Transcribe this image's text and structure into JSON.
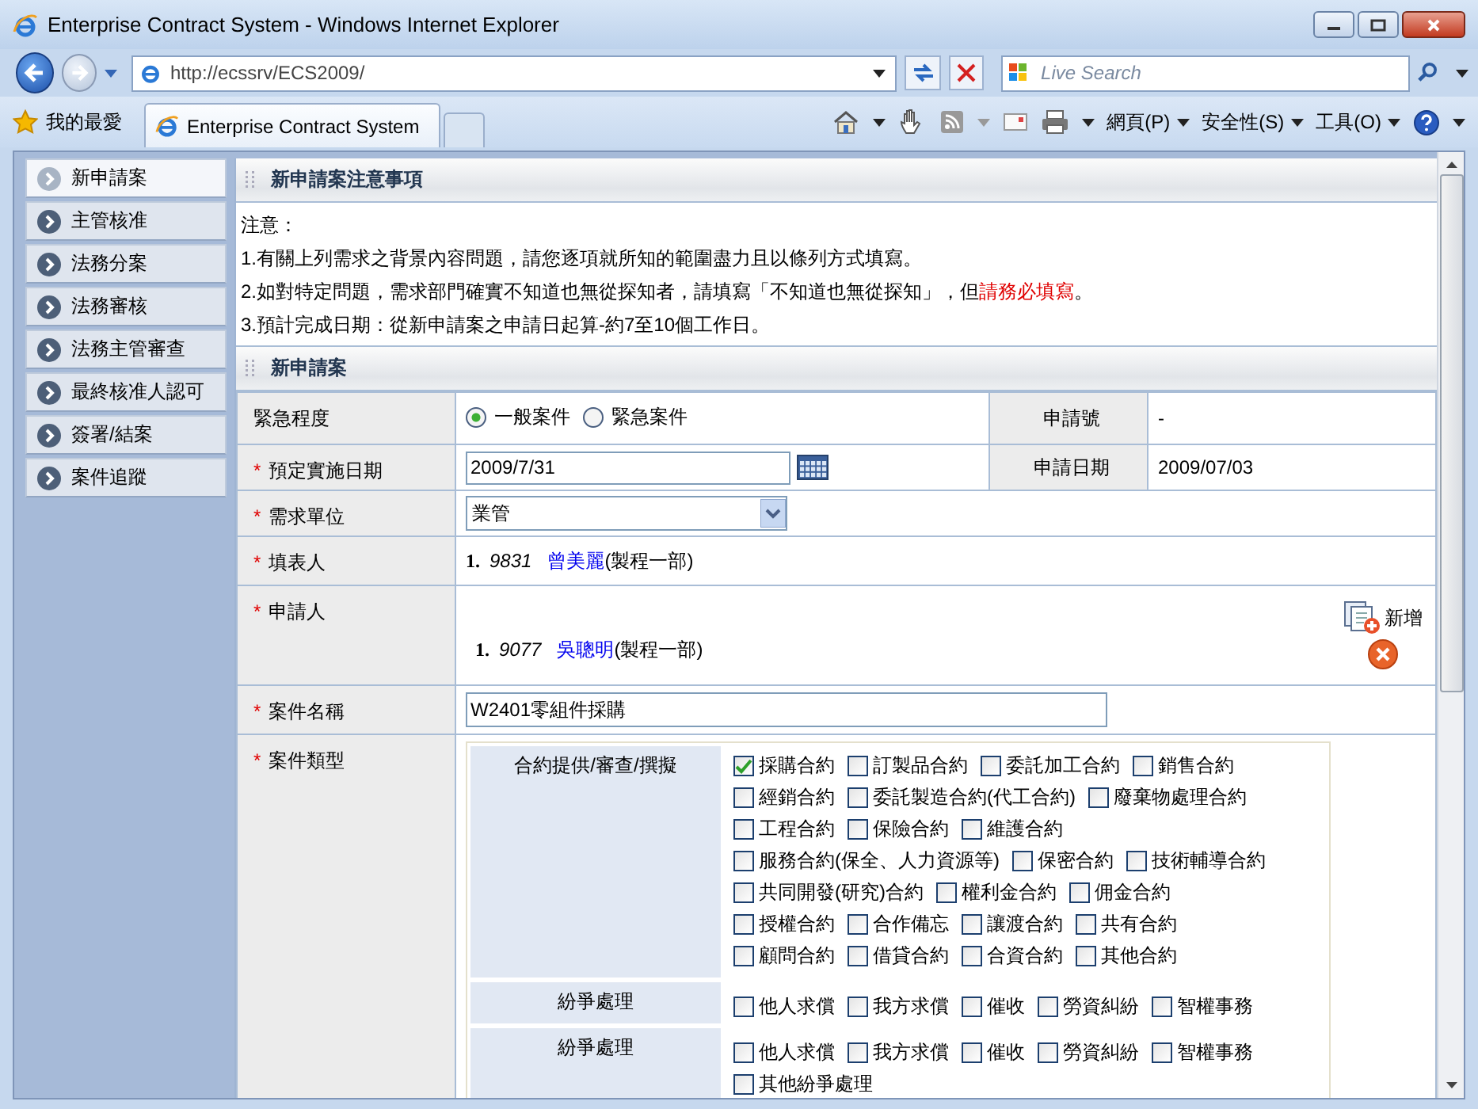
{
  "window": {
    "title": "Enterprise Contract System - Windows Internet Explorer"
  },
  "address_bar": {
    "url": "http://ecssrv/ECS2009/"
  },
  "search": {
    "placeholder": "Live Search"
  },
  "favorites": {
    "label": "我的最愛"
  },
  "tabs": [
    {
      "label": "Enterprise Contract System",
      "selected": true
    }
  ],
  "command_bar": {
    "menus": [
      "網頁(P)",
      "安全性(S)",
      "工具(O)"
    ]
  },
  "sidebar": {
    "items": [
      {
        "label": "新申請案",
        "selected": true
      },
      {
        "label": "主管核准",
        "selected": false
      },
      {
        "label": "法務分案",
        "selected": false
      },
      {
        "label": "法務審核",
        "selected": false
      },
      {
        "label": "法務主管審查",
        "selected": false
      },
      {
        "label": "最終核准人認可",
        "selected": false
      },
      {
        "label": "簽署/結案",
        "selected": false
      },
      {
        "label": "案件追蹤",
        "selected": false
      }
    ]
  },
  "notice": {
    "title": "新申請案注意事項",
    "heading": "注意：",
    "lines": [
      {
        "text": "1.有關上列需求之背景內容問題，請您逐項就所知的範圍盡力且以條列方式填寫。"
      },
      {
        "text": "2.如對特定問題，需求部門確實不知道也無從探知者，請填寫「不知道也無從探知」，但",
        "warning": "請務必填寫",
        "after": "。"
      },
      {
        "text": "3.預計完成日期：從新申請案之申請日起算-約7至10個工作日。"
      }
    ]
  },
  "form": {
    "title": "新申請案",
    "urgency": {
      "label": "緊急程度",
      "options": [
        {
          "label": "一般案件",
          "selected": true
        },
        {
          "label": "緊急案件",
          "selected": false
        }
      ]
    },
    "request_no": {
      "label": "申請號",
      "value": "-"
    },
    "planned_date": {
      "label": "預定實施日期",
      "marker": "*",
      "value": "2009/7/31"
    },
    "request_date": {
      "label": "申請日期",
      "value": "2009/07/03"
    },
    "department": {
      "label": "需求單位",
      "marker": "*",
      "value": "業管"
    },
    "filler": {
      "label": "填表人",
      "marker": "*",
      "people": [
        {
          "index": "1.",
          "id": "9831",
          "name": "曾美麗",
          "unit": "(製程一部)"
        }
      ]
    },
    "applicant": {
      "label": "申請人",
      "marker": "*",
      "add_label": "新增",
      "people": [
        {
          "index": "1.",
          "id": "9077",
          "name": "吳聰明",
          "unit": "(製程一部)"
        }
      ]
    },
    "case_name": {
      "label": "案件名稱",
      "marker": "*",
      "value": "W2401零組件採購"
    },
    "case_type": {
      "label": "案件類型",
      "marker": "*",
      "groups": [
        {
          "title": "合約提供/審查/撰擬",
          "lines": [
            [
              {
                "label": "採購合約",
                "checked": true
              },
              {
                "label": "訂製品合約",
                "checked": false
              },
              {
                "label": "委託加工合約",
                "checked": false
              },
              {
                "label": "銷售合約",
                "checked": false
              }
            ],
            [
              {
                "label": "經銷合約",
                "checked": false
              },
              {
                "label": "委託製造合約(代工合約)",
                "checked": false
              },
              {
                "label": "廢棄物處理合約",
                "checked": false
              }
            ],
            [
              {
                "label": "工程合約",
                "checked": false
              },
              {
                "label": "保險合約",
                "checked": false
              },
              {
                "label": "維護合約",
                "checked": false
              }
            ],
            [
              {
                "label": "服務合約(保全、人力資源等)",
                "checked": false
              },
              {
                "label": "保密合約",
                "checked": false
              },
              {
                "label": "技術輔導合約",
                "checked": false
              }
            ],
            [
              {
                "label": "共同開發(研究)合約",
                "checked": false
              },
              {
                "label": "權利金合約",
                "checked": false
              },
              {
                "label": "佣金合約",
                "checked": false
              }
            ],
            [
              {
                "label": "授權合約",
                "checked": false
              },
              {
                "label": "合作備忘",
                "checked": false
              },
              {
                "label": "讓渡合約",
                "checked": false
              },
              {
                "label": "共有合約",
                "checked": false
              }
            ],
            [
              {
                "label": "顧問合約",
                "checked": false
              },
              {
                "label": "借貸合約",
                "checked": false
              },
              {
                "label": "合資合約",
                "checked": false
              },
              {
                "label": "其他合約",
                "checked": false
              }
            ]
          ]
        },
        {
          "title": "紛爭處理",
          "lines": [
            [
              {
                "label": "他人求償",
                "checked": false
              },
              {
                "label": "我方求償",
                "checked": false
              },
              {
                "label": "催收",
                "checked": false
              },
              {
                "label": "勞資糾紛",
                "checked": false
              },
              {
                "label": "智權事務",
                "checked": false
              }
            ]
          ]
        },
        {
          "title": "紛爭處理",
          "lines": [
            [
              {
                "label": "他人求償",
                "checked": false
              },
              {
                "label": "我方求償",
                "checked": false
              },
              {
                "label": "催收",
                "checked": false
              },
              {
                "label": "勞資糾紛",
                "checked": false
              },
              {
                "label": "智權事務",
                "checked": false
              }
            ],
            [
              {
                "label": "其他紛爭處理",
                "checked": false
              }
            ]
          ]
        }
      ]
    }
  }
}
